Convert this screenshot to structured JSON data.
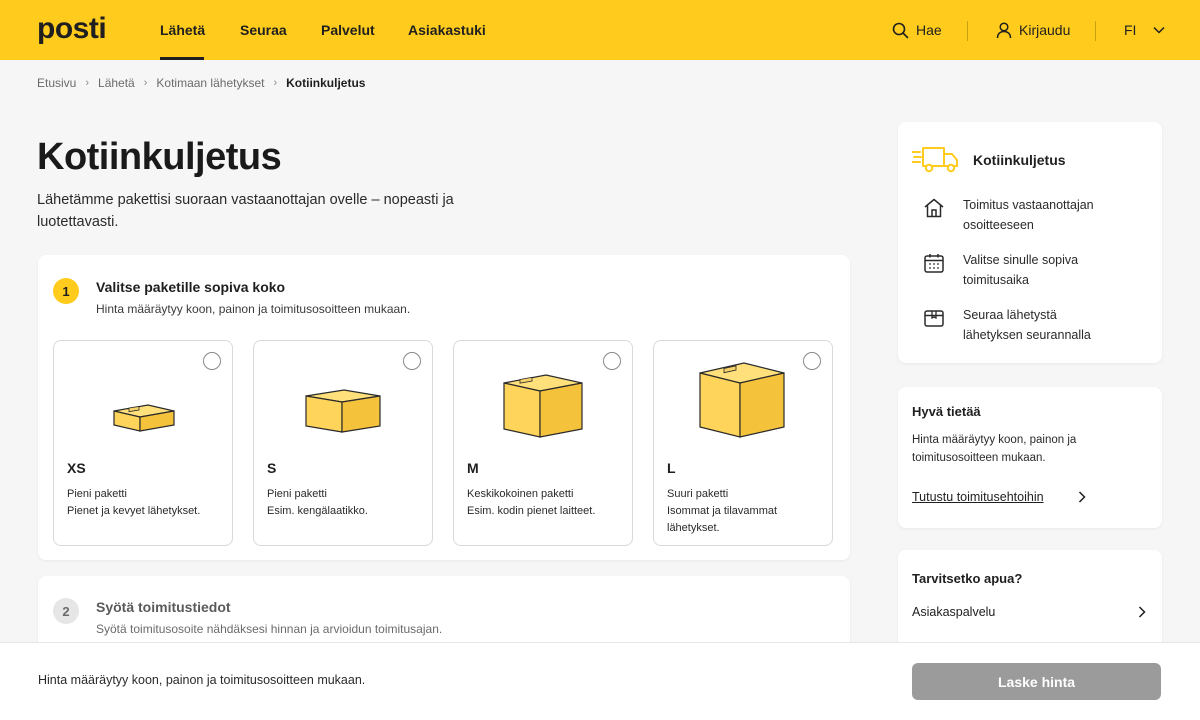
{
  "header": {
    "logo": "posti",
    "nav": [
      {
        "label": "Lähetä",
        "active": true
      },
      {
        "label": "Seuraa"
      },
      {
        "label": "Palvelut"
      },
      {
        "label": "Asiakastuki"
      }
    ],
    "search_label": "Hae",
    "login_label": "Kirjaudu",
    "language": "FI"
  },
  "breadcrumb": [
    "Etusivu",
    "Lähetä",
    "Kotimaan lähetykset",
    "Kotiinkuljetus"
  ],
  "page": {
    "title": "Kotiinkuljetus",
    "lead": "Lähetämme pakettisi suoraan vastaanottajan ovelle – nopeasti ja luotettavasti."
  },
  "step1": {
    "number": "1",
    "title": "Valitse paketille sopiva koko",
    "subtitle": "Hinta määräytyy koon, painon ja toimitusosoitteen mukaan.",
    "options": [
      {
        "size": "XS",
        "line1": "Pieni paketti",
        "line2": "Pienet ja kevyet lähetykset."
      },
      {
        "size": "S",
        "line1": "Pieni paketti",
        "line2": "Esim. kengälaatikko."
      },
      {
        "size": "M",
        "line1": "Keskikokoinen paketti",
        "line2": "Esim. kodin pienet laitteet."
      },
      {
        "size": "L",
        "line1": "Suuri paketti",
        "line2": "Isommat ja tilavammat lähetykset."
      }
    ]
  },
  "step2": {
    "number": "2",
    "title": "Syötä toimitustiedot",
    "subtitle": "Syötä toimitusosoite nähdäksesi hinnan ja arvioidun toimitusajan."
  },
  "info_card": {
    "title": "Kotiinkuljetus",
    "features": [
      {
        "icon": "home-icon",
        "text": "Toimitus vastaanottajan osoitteeseen"
      },
      {
        "icon": "calendar-icon",
        "text": "Valitse sinulle sopiva toimitusaika"
      },
      {
        "icon": "package-icon",
        "text": "Seuraa lähetystä lähetyksen seurannalla"
      }
    ]
  },
  "good_to_know": {
    "title": "Hyvä tietää",
    "text": "Hinta määräytyy koon, painon ja toimitusosoitteen mukaan.",
    "link": "Tutustu toimitusehtoihin"
  },
  "help": {
    "title": "Tarvitsetko apua?",
    "link": "Asiakaspalvelu"
  },
  "bottom_bar": {
    "text": "Hinta määräytyy koon, painon ja toimitusosoitteen mukaan.",
    "button": "Laske hinta"
  },
  "colors": {
    "brand_yellow": "#ffcc1d",
    "box_fill": "#ffd45a",
    "disabled_button": "#9b9b9b",
    "text": "#1f1f1f"
  }
}
